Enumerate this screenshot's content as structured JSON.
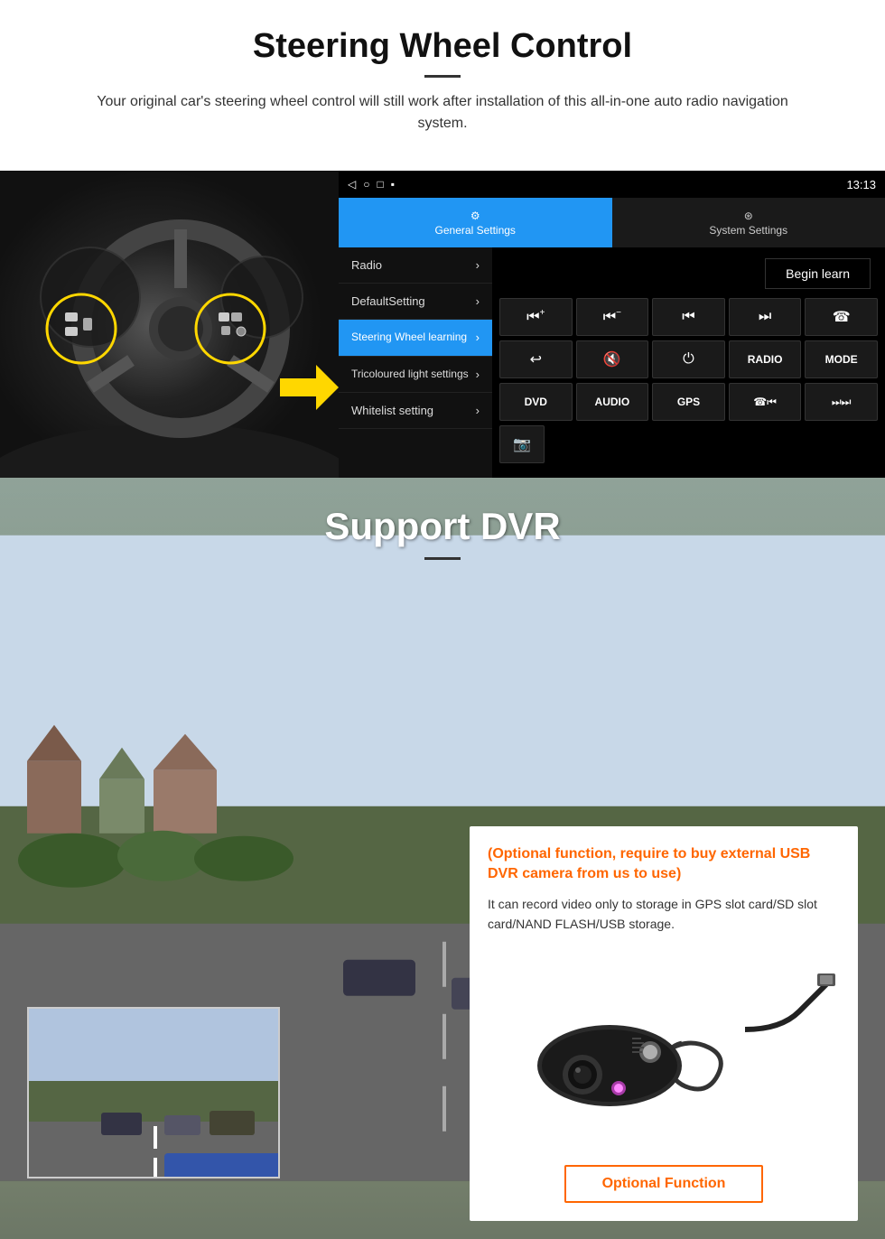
{
  "page": {
    "steering_section": {
      "title": "Steering Wheel Control",
      "subtitle": "Your original car's steering wheel control will still work after installation of this all-in-one auto radio navigation system.",
      "android_ui": {
        "statusbar": {
          "nav_back": "◁",
          "nav_home": "○",
          "nav_square": "□",
          "nav_dot": "▪",
          "time": "13:13",
          "signal": "▲"
        },
        "tab_general": "General Settings",
        "tab_system": "System Settings",
        "tab_general_icon": "⚙",
        "tab_system_icon": "⊛",
        "menu_items": [
          {
            "label": "Radio",
            "active": false
          },
          {
            "label": "DefaultSetting",
            "active": false
          },
          {
            "label": "Steering Wheel learning",
            "active": true
          },
          {
            "label": "Tricoloured light settings",
            "active": false
          },
          {
            "label": "Whitelist setting",
            "active": false
          }
        ],
        "begin_learn_label": "Begin learn",
        "control_buttons_row1": [
          {
            "icon": "⏮+",
            "label": "vol+prev"
          },
          {
            "icon": "⏮−",
            "label": "vol-prev"
          },
          {
            "icon": "⏮",
            "label": "prev"
          },
          {
            "icon": "⏭",
            "label": "next"
          },
          {
            "icon": "☎",
            "label": "phone"
          }
        ],
        "control_buttons_row2": [
          {
            "icon": "↩",
            "label": "back"
          },
          {
            "icon": "🔇×",
            "label": "mute"
          },
          {
            "icon": "⏻",
            "label": "power"
          },
          {
            "text": "RADIO",
            "label": "radio"
          },
          {
            "text": "MODE",
            "label": "mode"
          }
        ],
        "control_buttons_row3": [
          {
            "text": "DVD",
            "label": "dvd"
          },
          {
            "text": "AUDIO",
            "label": "audio"
          },
          {
            "text": "GPS",
            "label": "gps"
          },
          {
            "icon": "☎⏮",
            "label": "phone-prev"
          },
          {
            "icon": "⏭⏭",
            "label": "next-next"
          }
        ],
        "control_buttons_row4": [
          {
            "icon": "📷",
            "label": "camera"
          }
        ]
      }
    },
    "dvr_section": {
      "title": "Support DVR",
      "optional_text": "(Optional function, require to buy external USB DVR camera from us to use)",
      "description": "It can record video only to storage in GPS slot card/SD slot card/NAND FLASH/USB storage.",
      "optional_button_label": "Optional Function"
    }
  }
}
